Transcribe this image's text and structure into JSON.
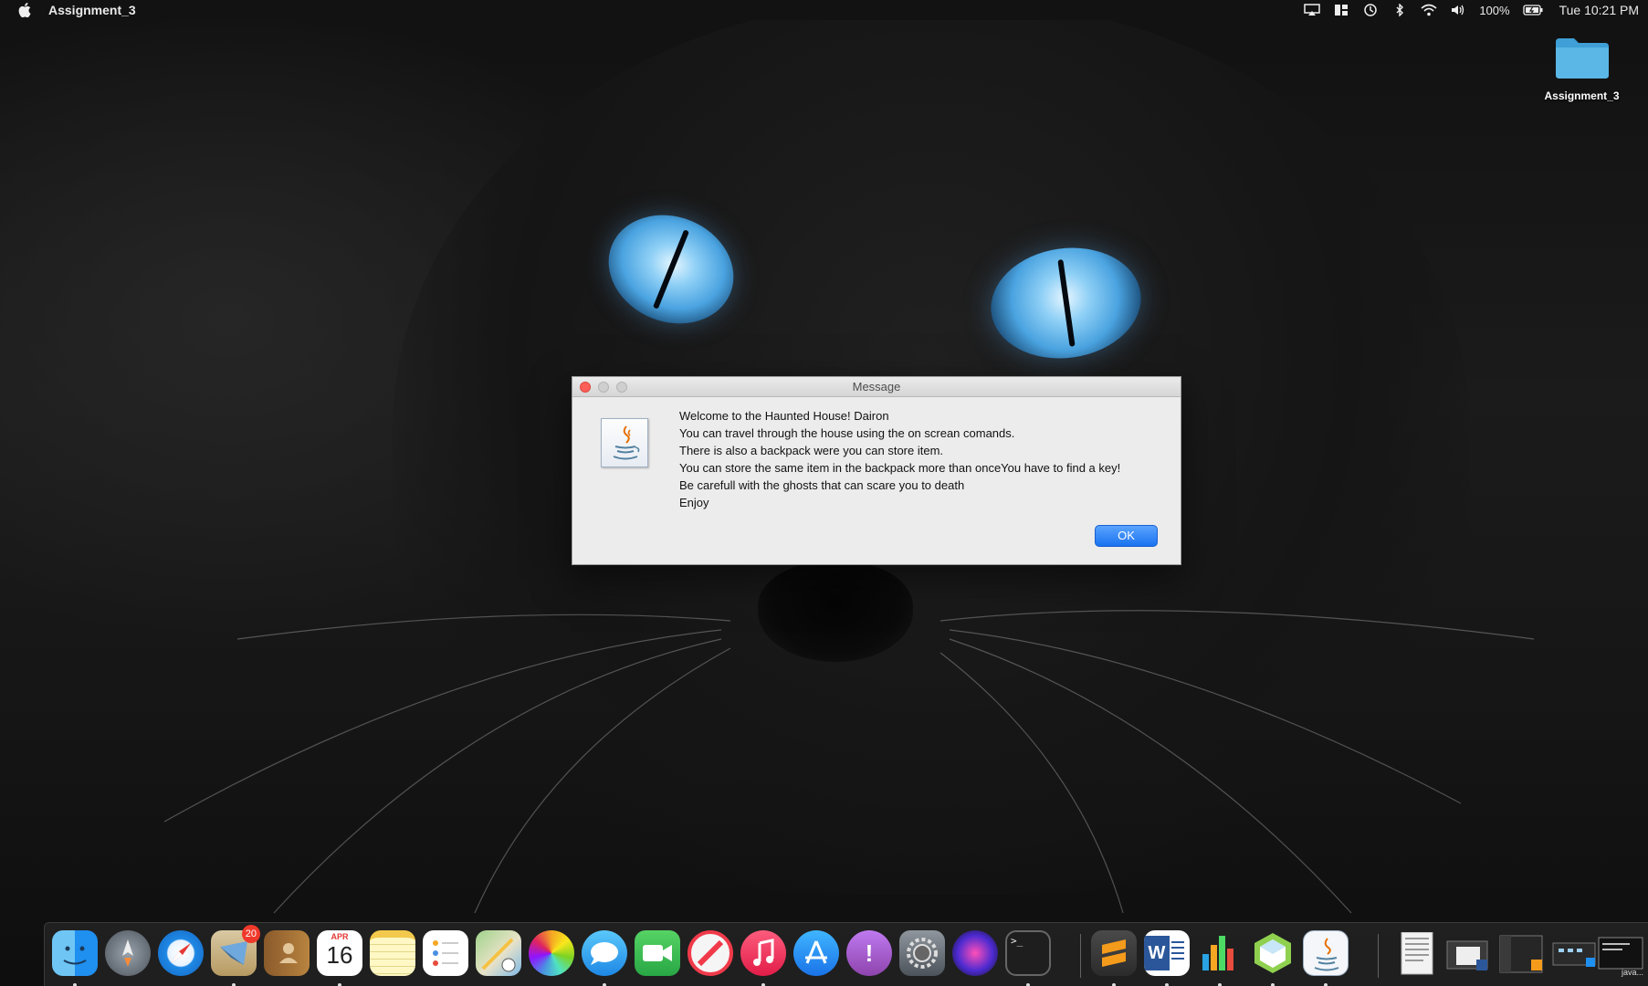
{
  "menubar": {
    "app_name": "Assignment_3",
    "battery": "100%",
    "clock": "Tue 10:21 PM",
    "icons": [
      "apple-icon",
      "airplay-icon",
      "layout-icon",
      "time-machine-icon",
      "bluetooth-icon",
      "wifi-icon",
      "volume-icon",
      "battery-icon"
    ]
  },
  "desktop": {
    "folder_label": "Assignment_3"
  },
  "dialog": {
    "title": "Message",
    "lines": [
      "Welcome to the Haunted House! Dairon",
      "You can travel through the house using the on screan comands.",
      "There is also a backpack were you can store item.",
      "You can store the same item in the backpack more than onceYou have to find a key!",
      "Be carefull with the ghosts that can scare you to death",
      "Enjoy"
    ],
    "ok_label": "OK"
  },
  "dock": {
    "calendar_month": "APR",
    "calendar_day": "16",
    "mail_badge": "20",
    "thumbnail_label": "java...",
    "apps": [
      "finder",
      "launchpad",
      "safari",
      "mail",
      "contacts",
      "calendar",
      "notes",
      "reminders",
      "maps",
      "photos",
      "messages",
      "facetime",
      "news",
      "music",
      "app-store",
      "feedback-assistant",
      "system-preferences",
      "siri",
      "terminal",
      "sublime-text",
      "word",
      "numbers",
      "virtualbox",
      "java"
    ]
  },
  "colors": {
    "ok_button": "#1a73f0",
    "close_button": "#fc5f57",
    "eye_blue": "#4aa3e0"
  }
}
